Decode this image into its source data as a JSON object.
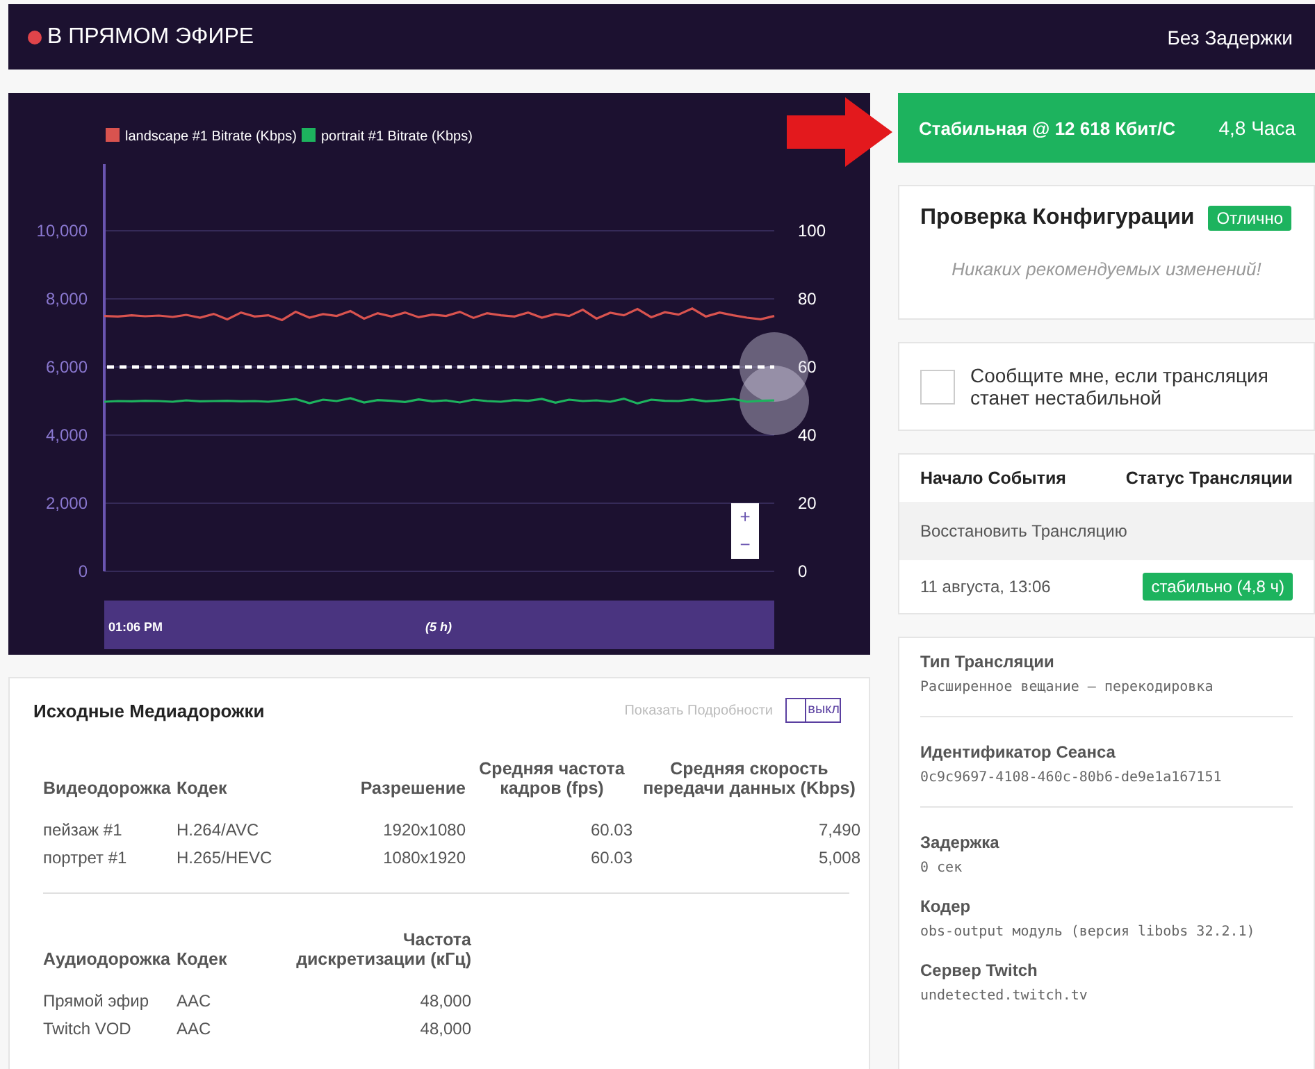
{
  "header": {
    "live": true,
    "live_label": "В ПРЯМОМ ЭФИРЕ",
    "latency_mode": "Без Задержки"
  },
  "chart": {
    "chart_data": {
      "type": "line",
      "ylim": [
        0,
        12000
      ],
      "yticks": [
        {
          "value": 0,
          "label": "0"
        },
        {
          "value": 2000,
          "label": "2,000"
        },
        {
          "value": 4000,
          "label": "4,000"
        },
        {
          "value": 6000,
          "label": "6,000"
        },
        {
          "value": 8000,
          "label": "8,000"
        },
        {
          "value": 10000,
          "label": "10,000"
        }
      ],
      "series": [
        {
          "name": "landscape #1 Bitrate (Kbps)",
          "color": "#d9534f",
          "values": [
            7500,
            7480,
            7520,
            7490,
            7510,
            7470,
            7530,
            7450,
            7560,
            7400,
            7600,
            7480,
            7520,
            7380,
            7620,
            7450,
            7550,
            7500,
            7640,
            7420,
            7580,
            7480,
            7600,
            7460,
            7540,
            7500,
            7620,
            7440,
            7580,
            7520,
            7480,
            7600,
            7450,
            7560,
            7500,
            7680,
            7420,
            7590,
            7520,
            7700,
            7460,
            7610,
            7540,
            7720,
            7480,
            7600,
            7520,
            7450,
            7400,
            7500
          ]
        },
        {
          "name": "portrait #1 Bitrate (Kbps)",
          "color": "#1db35e",
          "values": [
            4980,
            5000,
            4990,
            5010,
            5000,
            4980,
            5020,
            4990,
            5000,
            5010,
            4990,
            5000,
            4980,
            5020,
            5060,
            4940,
            5040,
            5000,
            5080,
            4960,
            5030,
            5010,
            4970,
            5050,
            4990,
            5020,
            4960,
            5040,
            5000,
            4980,
            5030,
            5010,
            5060,
            4950,
            5040,
            5000,
            5020,
            4980,
            5070,
            4930,
            5040,
            5010,
            5000,
            5050,
            4990,
            5020,
            5060,
            4980,
            5010,
            5020
          ]
        }
      ],
      "ref_lines": [
        {
          "axis": "y",
          "value": 6000
        }
      ],
      "grid": true,
      "legend": true
    },
    "right_axis_ticks": [
      "100",
      "80",
      "60",
      "40",
      "20",
      "0"
    ],
    "zoom_in": "+",
    "zoom_out": "−",
    "timeline": {
      "start": "01:06 PM",
      "span": "(5 h)"
    }
  },
  "media_tracks": {
    "title": "Исходные Медиадорожки",
    "details_toggle": {
      "label": "Показать Подробности",
      "state_text": "выкл",
      "on": false
    },
    "video": {
      "columns": [
        "Видеодорожка",
        "Кодек",
        "Разрешение",
        "Средняя частота кадров (fps)",
        "Средняя скорость передачи данных (Kbps)"
      ],
      "rows": [
        [
          "пейзаж #1",
          "H.264/AVC",
          "1920x1080",
          "60.03",
          "7,490"
        ],
        [
          "портрет #1",
          "H.265/HEVC",
          "1080x1920",
          "60.03",
          "5,008"
        ]
      ]
    },
    "audio": {
      "columns": [
        "Аудиодорожка",
        "Кодек",
        "Частота дискретизации (кГц)"
      ],
      "rows": [
        [
          "Прямой эфир",
          "AAC",
          "48,000"
        ],
        [
          "Twitch VOD",
          "AAC",
          "48,000"
        ]
      ]
    }
  },
  "stream_health": {
    "status": "Стабильная @ 12 618 Кбит/С",
    "duration": "4,8 Часа"
  },
  "config_check": {
    "title": "Проверка Конфигурации",
    "badge": "Отлично",
    "message": "Никаких рекомендуемых изменений!"
  },
  "notify": {
    "label": "Сообщите мне, если трансляция станет нестабильной",
    "checked": false
  },
  "events": {
    "columns": [
      "Начало События",
      "Статус Трансляции"
    ],
    "rows": [
      {
        "kind": "action",
        "label": "Восстановить Трансляцию"
      },
      {
        "kind": "session",
        "time": "11 августа, 13:06",
        "status": "стабильно (4,8 ч)"
      }
    ]
  },
  "detail_groups": [
    [
      {
        "label": "Тип Трансляции",
        "value": "Расширенное вещание — перекодировка"
      }
    ],
    [
      {
        "label": "Идентификатор Сеанса",
        "value": "0c9c9697-4108-460c-80b6-de9e1a167151"
      }
    ],
    [
      {
        "label": "Задержка",
        "value": "0 сек"
      },
      {
        "label": "Кодер",
        "value": "obs-output модуль (версия libobs 32.2.1)"
      },
      {
        "label": "Сервер Twitch",
        "value": "undetected.twitch.tv"
      }
    ]
  ]
}
